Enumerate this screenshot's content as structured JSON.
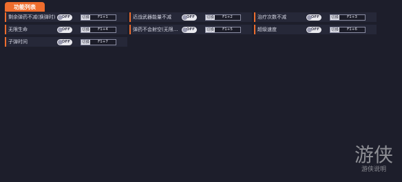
{
  "header": {
    "title": "功能列表"
  },
  "features": [
    {
      "label": "剩余弹药不减(换弹时)",
      "toggle": "OFF",
      "switch_label": "切换",
      "hotkey": "F1+1"
    },
    {
      "label": "近战武器能量不减",
      "toggle": "OFF",
      "switch_label": "切换",
      "hotkey": "F1+2"
    },
    {
      "label": "治疗次数不减",
      "toggle": "OFF",
      "switch_label": "切换",
      "hotkey": "F1+3"
    },
    {
      "label": "无限生命",
      "toggle": "OFF",
      "switch_label": "切换",
      "hotkey": "F1+4"
    },
    {
      "label": "弹药不会射空(无限射...",
      "toggle": "OFF",
      "switch_label": "切换",
      "hotkey": "F1+5"
    },
    {
      "label": "超级速度",
      "toggle": "OFF",
      "switch_label": "切换",
      "hotkey": "F1+6"
    },
    {
      "label": "子弹时间",
      "toggle": "OFF",
      "switch_label": "切换",
      "hotkey": "F1+7"
    }
  ],
  "watermark": {
    "logo": "游侠",
    "caption": "游侠说明"
  },
  "colors": {
    "accent": "#ef6d2d",
    "background": "#1d1e2b",
    "row_bg": "#262838"
  }
}
